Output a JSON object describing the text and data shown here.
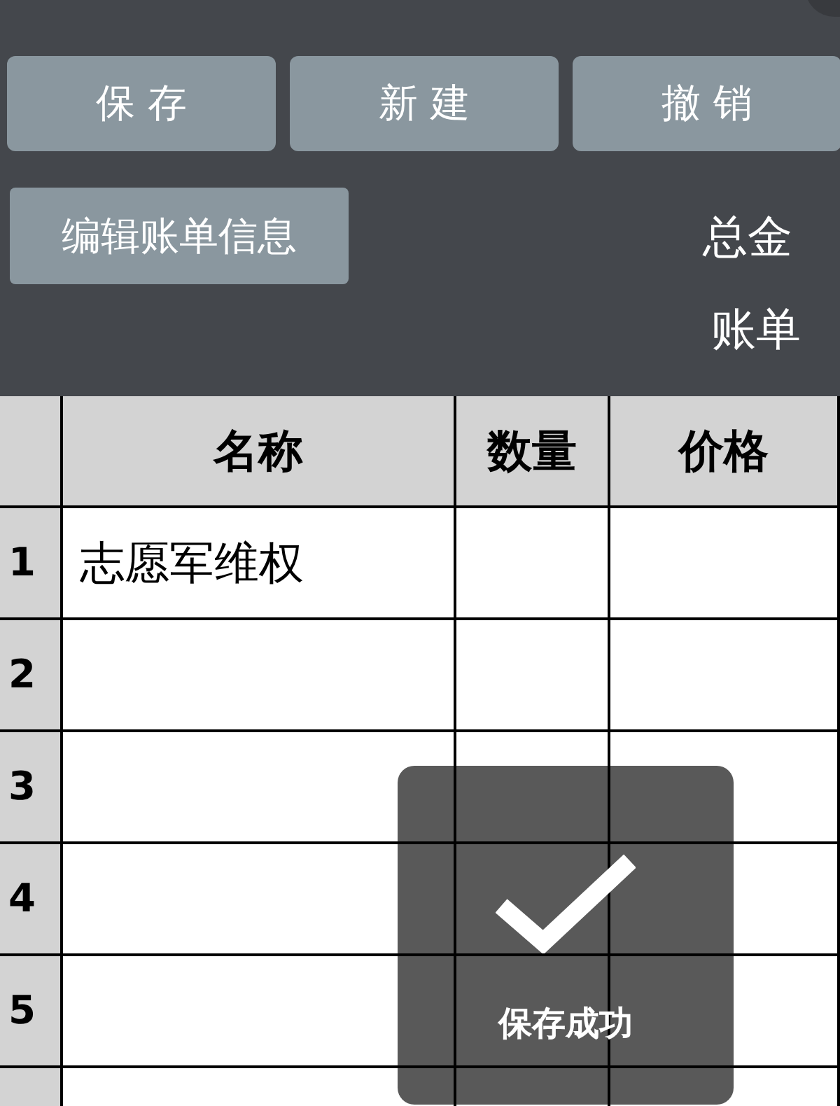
{
  "toolbar": {
    "buttons": [
      "保 存",
      "新 建",
      "撤 销"
    ]
  },
  "edit_button": "编辑账单信息",
  "summary": {
    "total_label": "总金",
    "date_label": "账单"
  },
  "table": {
    "columns": [
      "名称",
      "数量",
      "价格"
    ],
    "rows": [
      {
        "index": "1",
        "cells": [
          "志愿军维权",
          "",
          ""
        ]
      },
      {
        "index": "2",
        "cells": [
          "",
          "",
          ""
        ]
      },
      {
        "index": "3",
        "cells": [
          "",
          "",
          ""
        ]
      },
      {
        "index": "4",
        "cells": [
          "",
          "",
          ""
        ]
      },
      {
        "index": "5",
        "cells": [
          "",
          "",
          ""
        ]
      }
    ]
  },
  "toast": {
    "message": "保存成功"
  }
}
